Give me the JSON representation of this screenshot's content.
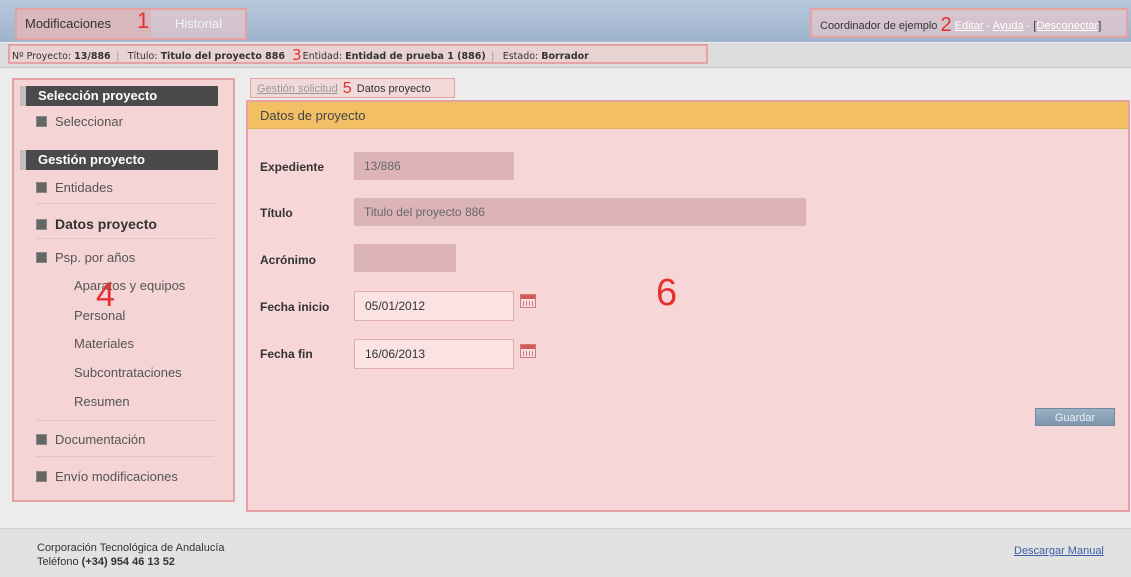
{
  "tabs": {
    "modificaciones": "Modificaciones",
    "historial": "Historial"
  },
  "markers": {
    "m1": "1",
    "m2": "2",
    "m3": "3",
    "m4": "4",
    "m5": "5",
    "m6": "6"
  },
  "user": {
    "name": "Coordinador de ejemplo",
    "editar": "Editar",
    "ayuda": "Ayuda",
    "desconectar": "Desconectar",
    "dash": "-",
    "open_bracket": "[",
    "close_bracket": "]"
  },
  "info": {
    "proyecto_label": "Nº Proyecto:",
    "proyecto_value": "13/886",
    "titulo_label": "Título:",
    "titulo_value": "Titulo del proyecto 886",
    "entidad_label": "Entidad:",
    "entidad_value": "Entidad de prueba 1 (886)",
    "estado_label": "Estado:",
    "estado_value": "Borrador"
  },
  "sidebar": {
    "seleccion_head": "Selección proyecto",
    "seleccionar": "Seleccionar",
    "gestion_head": "Gestión proyecto",
    "entidades": "Entidades",
    "datos_proyecto": "Datos proyecto",
    "psp": "Psp. por años",
    "sub": [
      "Aparatos y equipos",
      "Personal",
      "Materiales",
      "Subcontrataciones",
      "Resumen"
    ],
    "documentacion": "Documentación",
    "envio": "Envío modificaciones"
  },
  "breadcrumb": {
    "gestion": "Gestión solicitud",
    "current": "Datos proyecto"
  },
  "form": {
    "section_title": "Datos de proyecto",
    "expediente_label": "Expediente",
    "expediente_value": "13/886",
    "titulo_label": "Título",
    "titulo_value": "Titulo del proyecto 886",
    "acronimo_label": "Acrónimo",
    "acronimo_value": "",
    "fecha_inicio_label": "Fecha inicio",
    "fecha_inicio_value": "05/01/2012",
    "fecha_fin_label": "Fecha fin",
    "fecha_fin_value": "16/06/2013",
    "guardar": "Guardar"
  },
  "footer": {
    "org": "Corporación Tecnológica de Andalucía",
    "phone_label": "Teléfono",
    "phone": "(+34) 954 46 13 52",
    "manual": "Descargar Manual"
  },
  "colors": {
    "highlight_border": "#e6a2a2",
    "section_header": "#f2bf64",
    "top_bar": "#9eb3cc"
  }
}
